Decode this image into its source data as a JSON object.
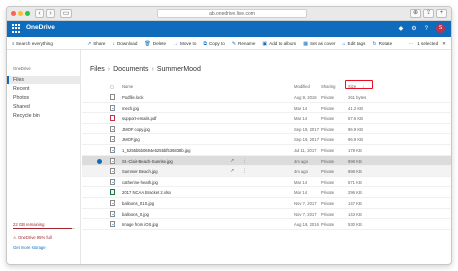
{
  "browser": {
    "url": "ab.onedrive.live.com",
    "back": "‹",
    "forward": "›",
    "sidebar_toggle": "▭",
    "right_buttons": [
      "⊕",
      "⇪",
      "+"
    ]
  },
  "app": {
    "brand": "OneDrive",
    "avatar_initial": "S"
  },
  "toolbar": {
    "search_placeholder": "Search everything",
    "commands": [
      {
        "label": "Share",
        "icon": "share-icon",
        "glyph": "↗"
      },
      {
        "label": "Download",
        "icon": "download-icon",
        "glyph": "↓"
      },
      {
        "label": "Delete",
        "icon": "delete-icon",
        "glyph": "🗑"
      },
      {
        "label": "Move to",
        "icon": "move-icon",
        "glyph": "→"
      },
      {
        "label": "Copy to",
        "icon": "copy-icon",
        "glyph": "⧉"
      },
      {
        "label": "Rename",
        "icon": "rename-icon",
        "glyph": "✎"
      },
      {
        "label": "Add to album",
        "icon": "album-icon",
        "glyph": "▣"
      },
      {
        "label": "Set as cover",
        "icon": "cover-icon",
        "glyph": "▦"
      },
      {
        "label": "Edit tags",
        "icon": "tag-icon",
        "glyph": "⌂"
      },
      {
        "label": "Rotate",
        "icon": "rotate-icon",
        "glyph": "↻"
      }
    ],
    "more": "···",
    "selected_text": "1 selected",
    "close": "✕"
  },
  "sidebar": {
    "header": "OneDrive",
    "items": [
      {
        "label": "Files",
        "active": true
      },
      {
        "label": "Recent",
        "active": false
      },
      {
        "label": "Photos",
        "active": false
      },
      {
        "label": "Shared",
        "active": false
      },
      {
        "label": "Recycle bin",
        "active": false
      }
    ],
    "storage_text": "22 GB remaining",
    "storage_used_fraction": 0.95,
    "warning_text": "OneDrive 95% full",
    "get_more": "Get more storage"
  },
  "breadcrumb": [
    "Files",
    "Documents",
    "SummerMood"
  ],
  "table": {
    "headers": {
      "name": "Name",
      "modified": "Modified",
      "sharing": "Sharing",
      "size": "Size"
    },
    "sort_indicator": "↓",
    "rows": [
      {
        "name": "Podfile.lock",
        "modified": "Aug 9, 2016",
        "sharing": "Private",
        "size": "261 bytes",
        "type": "doc"
      },
      {
        "name": "mech.jpg",
        "modified": "Mar 14",
        "sharing": "Private",
        "size": "41.2 KB",
        "type": "img"
      },
      {
        "name": "support-emails.pdf",
        "modified": "Mar 14",
        "sharing": "Private",
        "size": "67.6 KB",
        "type": "pdf"
      },
      {
        "name": "JMOF copy.jpg",
        "modified": "Sep 19, 2017",
        "sharing": "Private",
        "size": "96.9 KB",
        "type": "img"
      },
      {
        "name": "JMOF.jpg",
        "modified": "Sep 19, 2017",
        "sharing": "Private",
        "size": "96.9 KB",
        "type": "img"
      },
      {
        "name": "1_5255b5b0694e5255bf536838b.jpg",
        "modified": "Jul 11, 2017",
        "sharing": "Private",
        "size": "178 KB",
        "type": "img"
      },
      {
        "name": "St.-Clair-Beach-Sunrise.jpg",
        "modified": "4m ago",
        "sharing": "Private",
        "size": "898 KB",
        "type": "img",
        "state": "selected"
      },
      {
        "name": "Summer Beach.jpg",
        "modified": "4m ago",
        "sharing": "Private",
        "size": "898 KB",
        "type": "img",
        "state": "hover"
      },
      {
        "name": "catherine-heath.jpg",
        "modified": "Mar 14",
        "sharing": "Private",
        "size": "671 KB",
        "type": "img"
      },
      {
        "name": "2017 NCAA Bracket 2.xlsx",
        "modified": "Mar 14",
        "sharing": "Private",
        "size": "296 KB",
        "type": "xls"
      },
      {
        "name": "balloons_01S.jpg",
        "modified": "Nov 7, 2017",
        "sharing": "Private",
        "size": "147 KB",
        "type": "img"
      },
      {
        "name": "balloons_0.jpg",
        "modified": "Nov 7, 2017",
        "sharing": "Private",
        "size": "143 KB",
        "type": "img"
      },
      {
        "name": "Image from iOS.jpg",
        "modified": "Aug 19, 2016",
        "sharing": "Private",
        "size": "530 KB",
        "type": "img"
      }
    ]
  },
  "colors": {
    "brand": "#0f6cbd",
    "warning": "#a4262c",
    "sort_highlight": "#e81123"
  }
}
